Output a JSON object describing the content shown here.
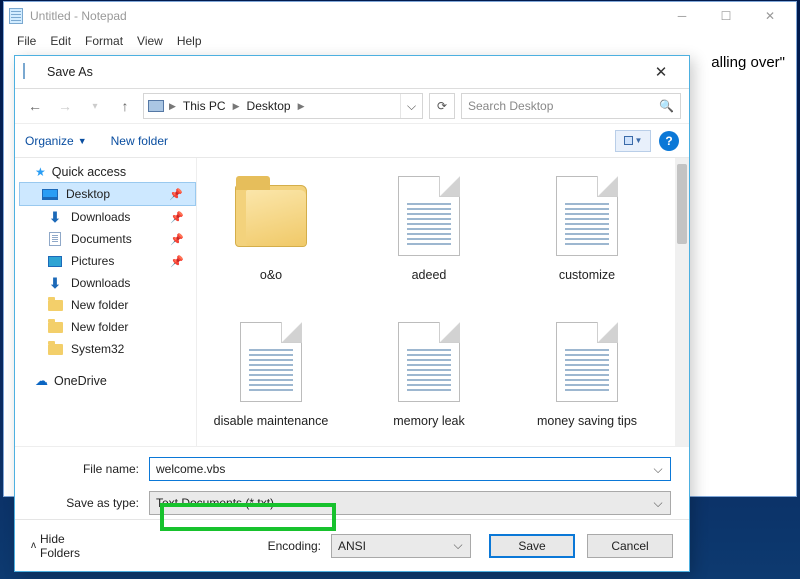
{
  "notepad": {
    "title": "Untitled - Notepad",
    "menu": [
      "File",
      "Edit",
      "Format",
      "View",
      "Help"
    ],
    "editor_fragment": "alling over\""
  },
  "dialog": {
    "title": "Save As",
    "breadcrumb": {
      "root_icon": "pc-icon",
      "items": [
        "This PC",
        "Desktop"
      ]
    },
    "search_placeholder": "Search Desktop",
    "toolbar": {
      "organize": "Organize",
      "new_folder": "New folder"
    },
    "sidebar": {
      "quick_access": "Quick access",
      "items": [
        {
          "label": "Desktop",
          "icon": "monitor",
          "pinned": true,
          "selected": true
        },
        {
          "label": "Downloads",
          "icon": "download",
          "pinned": true
        },
        {
          "label": "Documents",
          "icon": "document",
          "pinned": true
        },
        {
          "label": "Pictures",
          "icon": "pictures",
          "pinned": true
        },
        {
          "label": "Downloads",
          "icon": "download"
        },
        {
          "label": "New folder",
          "icon": "folder"
        },
        {
          "label": "New folder",
          "icon": "folder"
        },
        {
          "label": "System32",
          "icon": "folder"
        }
      ],
      "onedrive": "OneDrive"
    },
    "files": [
      {
        "label": "o&o",
        "type": "folder"
      },
      {
        "label": "adeed",
        "type": "text"
      },
      {
        "label": "customize",
        "type": "text"
      },
      {
        "label": "disable maintenance",
        "type": "text"
      },
      {
        "label": "memory leak",
        "type": "text"
      },
      {
        "label": "money saving tips",
        "type": "text"
      }
    ],
    "fields": {
      "filename_label": "File name:",
      "filename_value": "welcome.vbs",
      "type_label": "Save as type:",
      "type_value": "Text Documents (*.txt)"
    },
    "footer": {
      "hide_folders": "Hide Folders",
      "encoding_label": "Encoding:",
      "encoding_value": "ANSI",
      "save": "Save",
      "cancel": "Cancel"
    }
  }
}
